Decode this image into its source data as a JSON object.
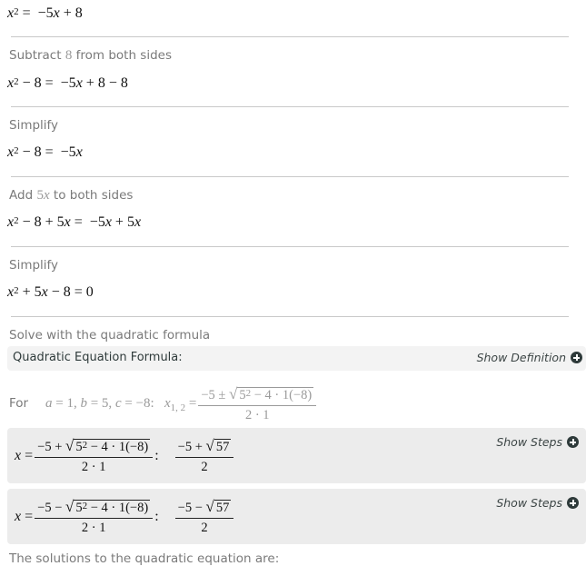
{
  "steps": [
    {
      "id": "start",
      "label": null,
      "equation": {
        "lhs": "x^2",
        "rhs": "−5x + 8"
      }
    },
    {
      "id": "subtract-8",
      "label": {
        "before": "Subtract ",
        "math": "8",
        "after": " from both sides"
      },
      "equation": {
        "lhs": "x^2 − 8",
        "rhs": "−5x + 8 − 8"
      }
    },
    {
      "id": "simplify-1",
      "label": {
        "before": "Simplify",
        "math": "",
        "after": ""
      },
      "equation": {
        "lhs": "x^2 − 8",
        "rhs": "−5x"
      }
    },
    {
      "id": "add-5x",
      "label": {
        "before": "Add ",
        "math": "5x",
        "after": " to both sides"
      },
      "equation": {
        "lhs": "x^2 − 8 + 5x",
        "rhs": "−5x + 5x"
      }
    },
    {
      "id": "simplify-2",
      "label": {
        "before": "Simplify",
        "math": "",
        "after": ""
      },
      "equation": {
        "lhs": "x^2 + 5x − 8",
        "rhs": "0"
      }
    }
  ],
  "quadratic": {
    "section_label": "Solve with the quadratic formula",
    "formula_header": "Quadratic Equation Formula:",
    "show_definition_label": "Show Definition",
    "for_label": "For",
    "coefficients": {
      "a": "1",
      "b": "5",
      "c": "−8"
    },
    "general": {
      "var": "x",
      "subscript": "1, 2",
      "numerator_pre": "−5 ± ",
      "radicand_base": "5",
      "radicand_exp": "2",
      "radicand_rest": " − 4 · 1(−8)",
      "denominator": "2 · 1"
    },
    "solutions": [
      {
        "sign": "+",
        "numerator_pre": "−5 + ",
        "radicand_base": "5",
        "radicand_exp": "2",
        "radicand_rest": " − 4 · 1(−8)",
        "denominator": "2 · 1",
        "result_pre": "−5 + ",
        "result_radicand": "57",
        "result_denominator": "2",
        "show_steps_label": "Show Steps"
      },
      {
        "sign": "−",
        "numerator_pre": "−5 − ",
        "radicand_base": "5",
        "radicand_exp": "2",
        "radicand_rest": " − 4 · 1(−8)",
        "denominator": "2 · 1",
        "result_pre": "−5 − ",
        "result_radicand": "57",
        "result_denominator": "2",
        "show_steps_label": "Show Steps"
      }
    ],
    "conclusion": "The solutions to the quadratic equation are:"
  }
}
